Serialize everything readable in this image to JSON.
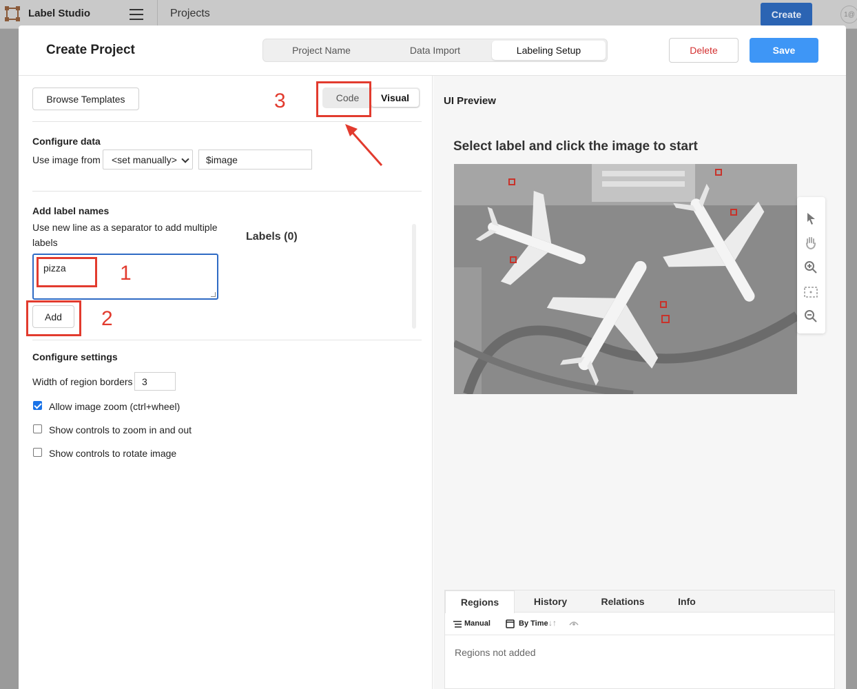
{
  "appbar": {
    "brand": "Label Studio",
    "breadcrumb": "Projects",
    "create_label": "Create",
    "avatar_text": "1@"
  },
  "modal": {
    "title": "Create Project",
    "steps": [
      "Project Name",
      "Data Import",
      "Labeling Setup"
    ],
    "active_step": "Labeling Setup",
    "delete_label": "Delete",
    "save_label": "Save"
  },
  "config": {
    "browse_label": "Browse Templates",
    "mode_code": "Code",
    "mode_visual": "Visual",
    "active_mode": "Visual",
    "configure_data_title": "Configure data",
    "use_image_from_label": "Use image from",
    "use_image_from_value": "<set manually>",
    "image_var_value": "$image",
    "add_label_title": "Add label names",
    "add_label_help": "Use new line as a separator to add multiple labels",
    "label_input_value": "pizza",
    "add_button": "Add",
    "labels_title": "Labels (0)",
    "settings_title": "Configure settings",
    "border_width_label": "Width of region borders",
    "border_width_value": "3",
    "options": [
      {
        "label": "Allow image zoom (ctrl+wheel)",
        "checked": true
      },
      {
        "label": "Show controls to zoom in and out",
        "checked": false
      },
      {
        "label": "Show controls to rotate image",
        "checked": false
      }
    ]
  },
  "annotations": {
    "step1": "1",
    "step2": "2",
    "step3": "3",
    "color": "#e23b2e"
  },
  "preview": {
    "title": "UI Preview",
    "prompt": "Select label and click the image to start",
    "image_alt": "aerial view of airport with three airplanes",
    "tools": [
      "pointer-icon",
      "hand-icon",
      "zoom-in-icon",
      "fit-icon",
      "zoom-out-icon"
    ],
    "tabs": [
      "Regions",
      "History",
      "Relations",
      "Info"
    ],
    "active_tab": "Regions",
    "sort_manual": "Manual",
    "sort_by_time": "By Time",
    "empty_text": "Regions not added"
  },
  "colors": {
    "accent": "#3e96f6",
    "delete": "#d32f2f",
    "active_input_border": "#2e6ac4"
  }
}
